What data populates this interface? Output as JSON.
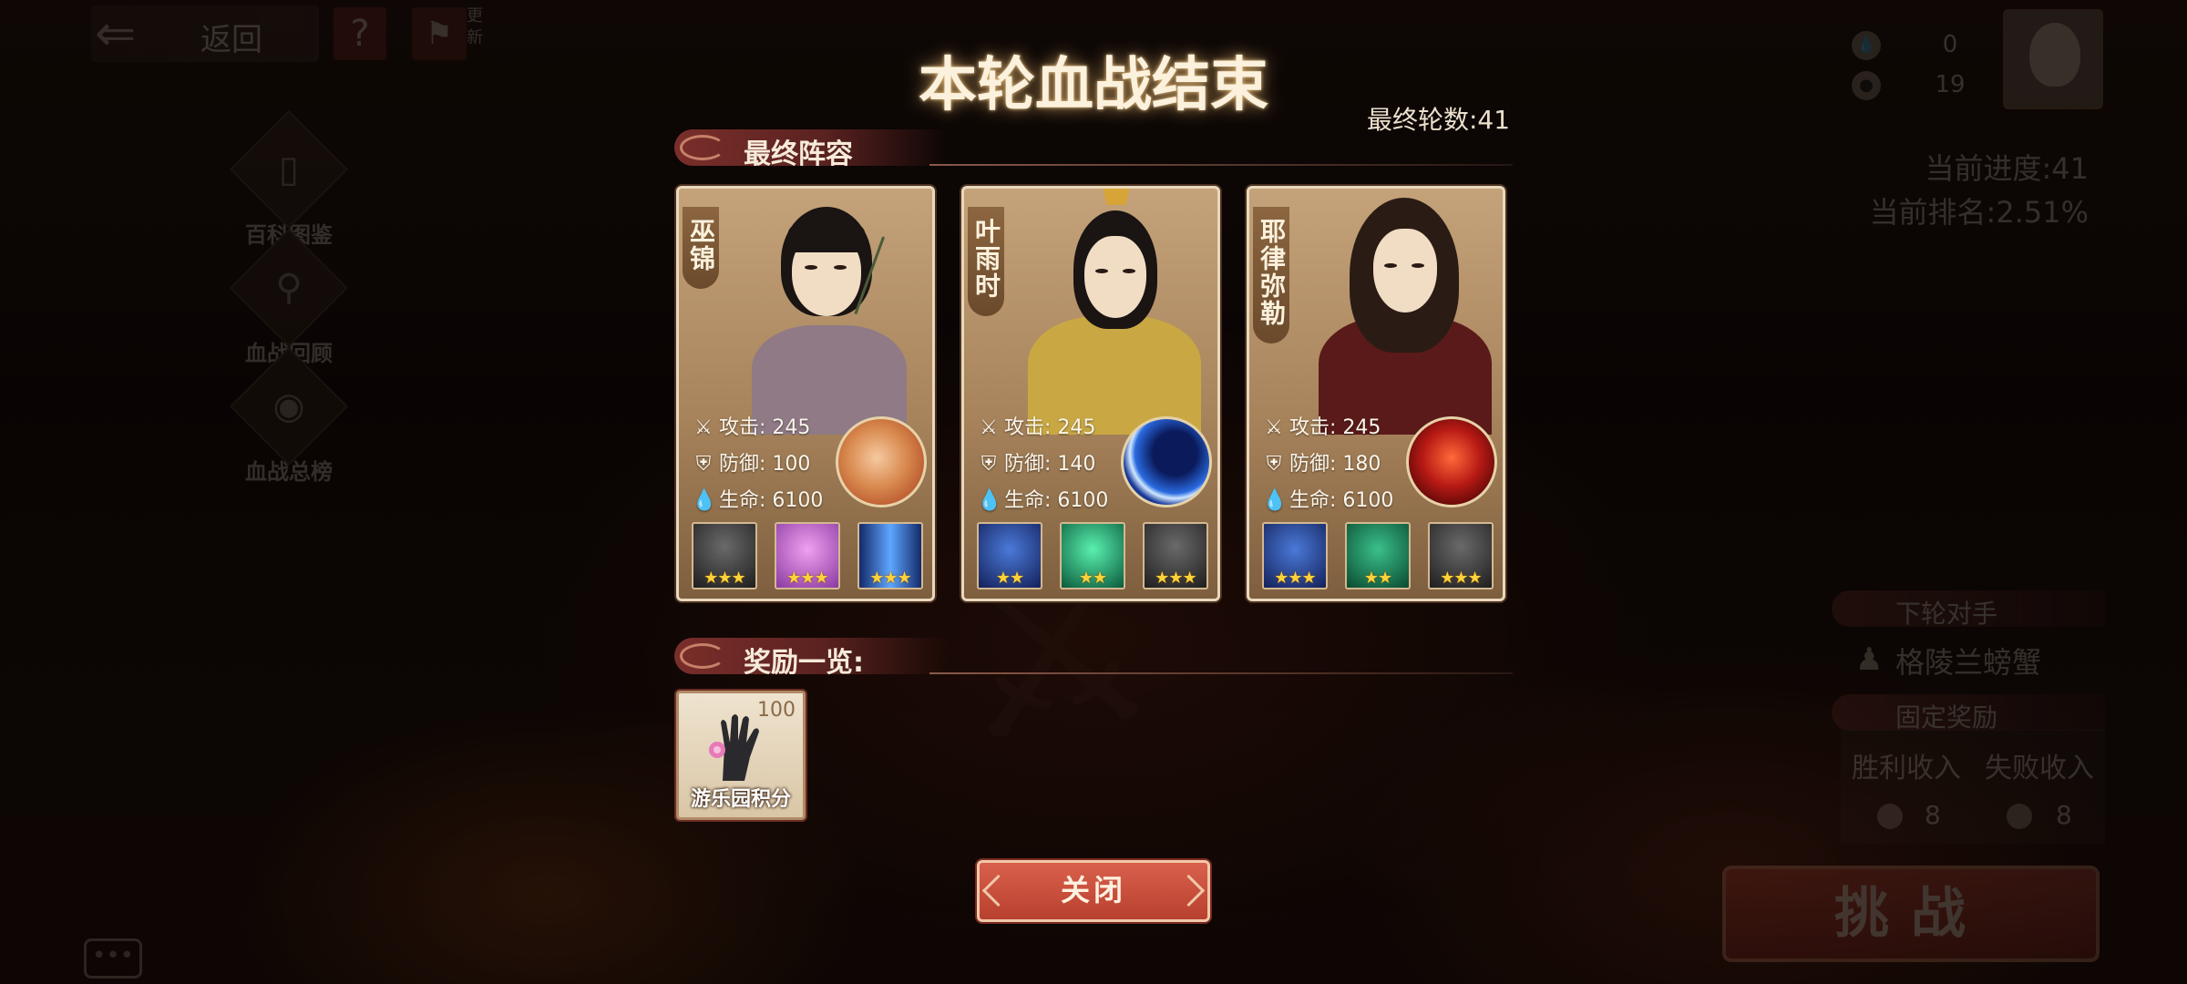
{
  "top_bar": {
    "back_label": "返回",
    "help_label": "?",
    "flag_side_text": "更新"
  },
  "side_nav": [
    {
      "label": "百科图鉴",
      "icon": "book-icon"
    },
    {
      "label": "血战回顾",
      "icon": "review-icon"
    },
    {
      "label": "血战总榜",
      "icon": "ranking-icon"
    }
  ],
  "resources": [
    {
      "icon": "blood-drop-icon",
      "value": "0"
    },
    {
      "icon": "coin-icon",
      "value": "19"
    }
  ],
  "status": {
    "progress": "当前进度:41",
    "rank": "当前排名:2.51%"
  },
  "next_opponent": {
    "title": "下轮对手",
    "name": "格陵兰螃蟹"
  },
  "fixed_reward": {
    "title": "固定奖励",
    "win_label": "胜利收入",
    "lose_label": "失败收入",
    "win_value": "8",
    "lose_value": "8"
  },
  "challenge_label": "挑战",
  "modal": {
    "title": "本轮血战结束",
    "final_round": "最终轮数:41",
    "lineup_title": "最终阵容",
    "rewards_title": "奖励一览:",
    "close_label": "关闭"
  },
  "heroes": [
    {
      "name": "巫锦",
      "attack_label": "攻击:",
      "attack": "245",
      "defense_label": "防御:",
      "defense": "100",
      "hp_label": "生命:",
      "hp": "6100",
      "skill_icon": "fist-icon",
      "equipment": [
        {
          "icon": "armor-icon",
          "stars": 3
        },
        {
          "icon": "purple-aura-icon",
          "stars": 3
        },
        {
          "icon": "blue-sword-icon",
          "stars": 3
        }
      ]
    },
    {
      "name": "叶雨时",
      "attack_label": "攻击:",
      "attack": "245",
      "defense_label": "防御:",
      "defense": "140",
      "hp_label": "生命:",
      "hp": "6100",
      "skill_icon": "crescent-moon-icon",
      "equipment": [
        {
          "icon": "blue-cloak-icon",
          "stars": 2
        },
        {
          "icon": "green-skull-icon",
          "stars": 2
        },
        {
          "icon": "armor-icon",
          "stars": 3
        }
      ]
    },
    {
      "name": "耶律弥勒",
      "attack_label": "攻击:",
      "attack": "245",
      "defense_label": "防御:",
      "defense": "180",
      "hp_label": "生命:",
      "hp": "6100",
      "skill_icon": "blood-demon-icon",
      "equipment": [
        {
          "icon": "blue-cloak-icon",
          "stars": 3
        },
        {
          "icon": "green-beast-icon",
          "stars": 2
        },
        {
          "icon": "armor-icon",
          "stars": 3
        }
      ]
    }
  ],
  "reward_item": {
    "name": "游乐园积分",
    "count": "100",
    "icon": "lotus-hand-icon"
  },
  "colors": {
    "accent_red": "#b8402e",
    "title_glow": "#ffc878",
    "star_gold": "#ffd23a"
  }
}
